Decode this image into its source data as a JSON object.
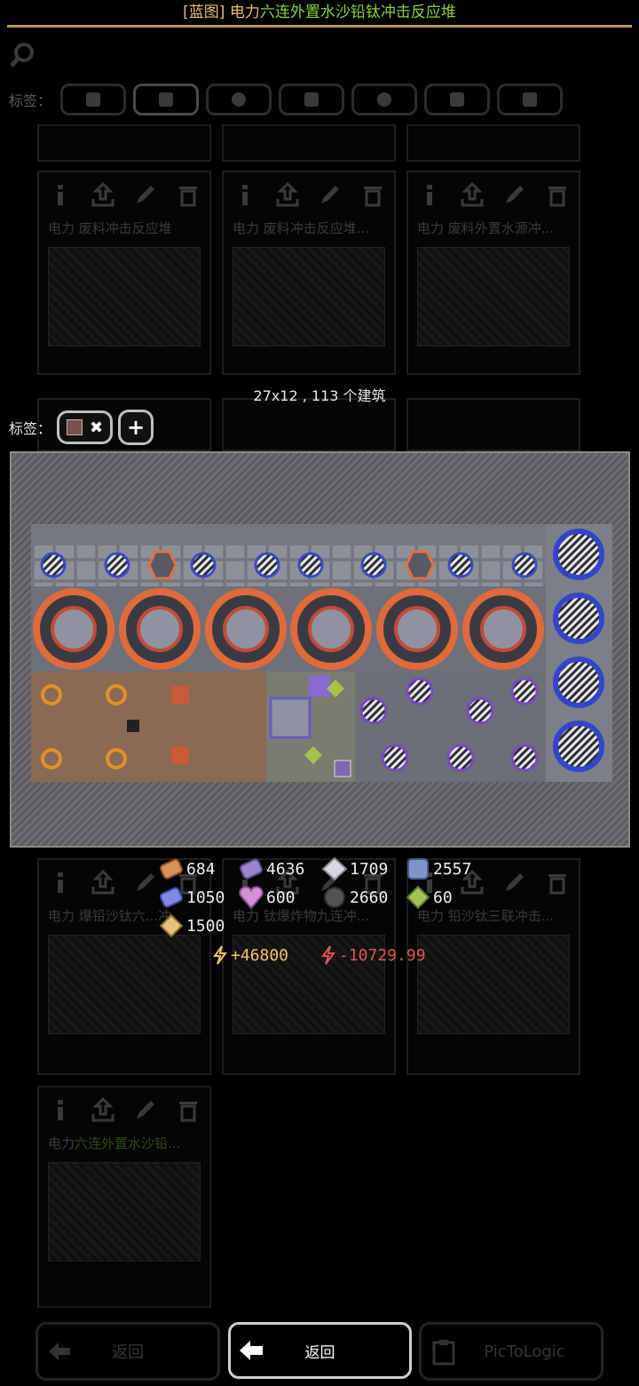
{
  "title": {
    "bracket": "[蓝图]",
    "prefix": "电力",
    "main": "六连外置水沙铅钛冲击反应堆"
  },
  "bg": {
    "tags_label": "标签：",
    "cards": [
      {
        "name": "电力 废料冲击反应堆",
        "hl": ""
      },
      {
        "name": "电力 废料冲击反应堆...",
        "hl": ""
      },
      {
        "name": "电力 废料外置水源冲...",
        "hl": ""
      },
      {
        "name": "电力 爆铅沙钛六...冲",
        "hl": ""
      },
      {
        "name": "电力 钛爆炸物九连冲...",
        "hl": ""
      },
      {
        "name": "电力 铅沙钛三联冲击...",
        "hl": ""
      },
      {
        "name": "电力",
        "hl": "六连外置水沙铅..."
      }
    ],
    "footer_back": "返回",
    "footer_pictologic": "PicToLogic"
  },
  "dialog": {
    "size_text": "27x12 , 113 个建筑",
    "tags_label": "标签：",
    "tag_remove": "✖",
    "tag_add": "+"
  },
  "costs": [
    {
      "icon": "copper-icon",
      "color": "#d9915a",
      "value": "684"
    },
    {
      "icon": "lead-icon",
      "color": "#9a86c9",
      "value": "4636"
    },
    {
      "icon": "metaglass-icon",
      "color": "#d7d7e2",
      "value": "1709"
    },
    {
      "icon": "titanium-icon",
      "color": "#7f95c9",
      "value": "2557"
    },
    {
      "icon": "plastanium-icon",
      "color": "#7f8ae0",
      "value": "1050"
    },
    {
      "icon": "phase-fabric-icon",
      "color": "#d48fd6",
      "value": "600"
    },
    {
      "icon": "silicon-icon",
      "color": "#4f5257",
      "value": "2660"
    },
    {
      "icon": "surge-alloy-icon",
      "color": "#a5c25a",
      "value": "60"
    },
    {
      "icon": "thorium-icon",
      "color": "#e3c27a",
      "value": "1500"
    }
  ],
  "power": {
    "generated": "+46800",
    "consumed": "-10729.99"
  },
  "back_label": "返回"
}
